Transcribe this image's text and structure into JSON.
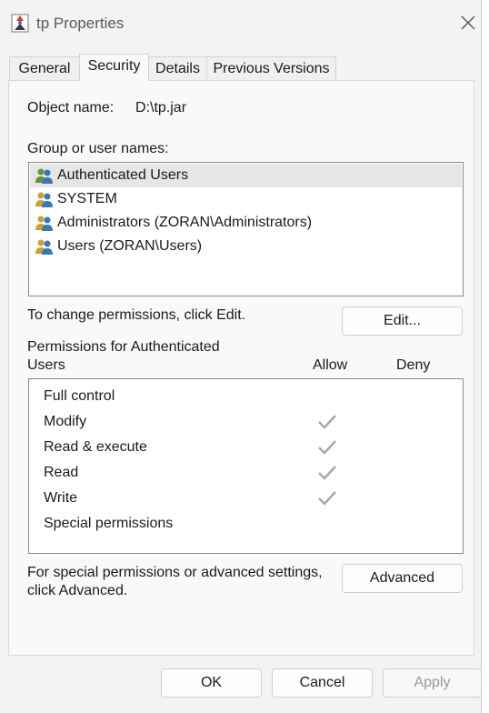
{
  "window": {
    "title": "tp Properties"
  },
  "tabs": [
    {
      "label": "General",
      "active": false
    },
    {
      "label": "Security",
      "active": true
    },
    {
      "label": "Details",
      "active": false
    },
    {
      "label": "Previous Versions",
      "active": false
    }
  ],
  "object": {
    "label": "Object name:",
    "value": "D:\\tp.jar"
  },
  "groups": {
    "label": "Group or user names:",
    "items": [
      {
        "label": "Authenticated Users",
        "selected": true
      },
      {
        "label": "SYSTEM",
        "selected": false
      },
      {
        "label": "Administrators (ZORAN\\Administrators)",
        "selected": false
      },
      {
        "label": "Users (ZORAN\\Users)",
        "selected": false
      }
    ]
  },
  "change": {
    "text": "To change permissions, click Edit.",
    "edit_label": "Edit..."
  },
  "permissions": {
    "header_line1": "Permissions for Authenticated",
    "header_line2": "Users",
    "allow_label": "Allow",
    "deny_label": "Deny",
    "rows": [
      {
        "name": "Full control",
        "allow": false,
        "deny": false
      },
      {
        "name": "Modify",
        "allow": true,
        "deny": false
      },
      {
        "name": "Read & execute",
        "allow": true,
        "deny": false
      },
      {
        "name": "Read",
        "allow": true,
        "deny": false
      },
      {
        "name": "Write",
        "allow": true,
        "deny": false
      },
      {
        "name": "Special permissions",
        "allow": false,
        "deny": false
      }
    ]
  },
  "advanced": {
    "text_line1": "For special permissions or advanced settings,",
    "text_line2": "click Advanced.",
    "button_label": "Advanced"
  },
  "footer": {
    "ok_label": "OK",
    "cancel_label": "Cancel",
    "apply_label": "Apply"
  },
  "colors": {
    "check": "#a6a6a6",
    "selected_row": "#e6e6e6"
  }
}
